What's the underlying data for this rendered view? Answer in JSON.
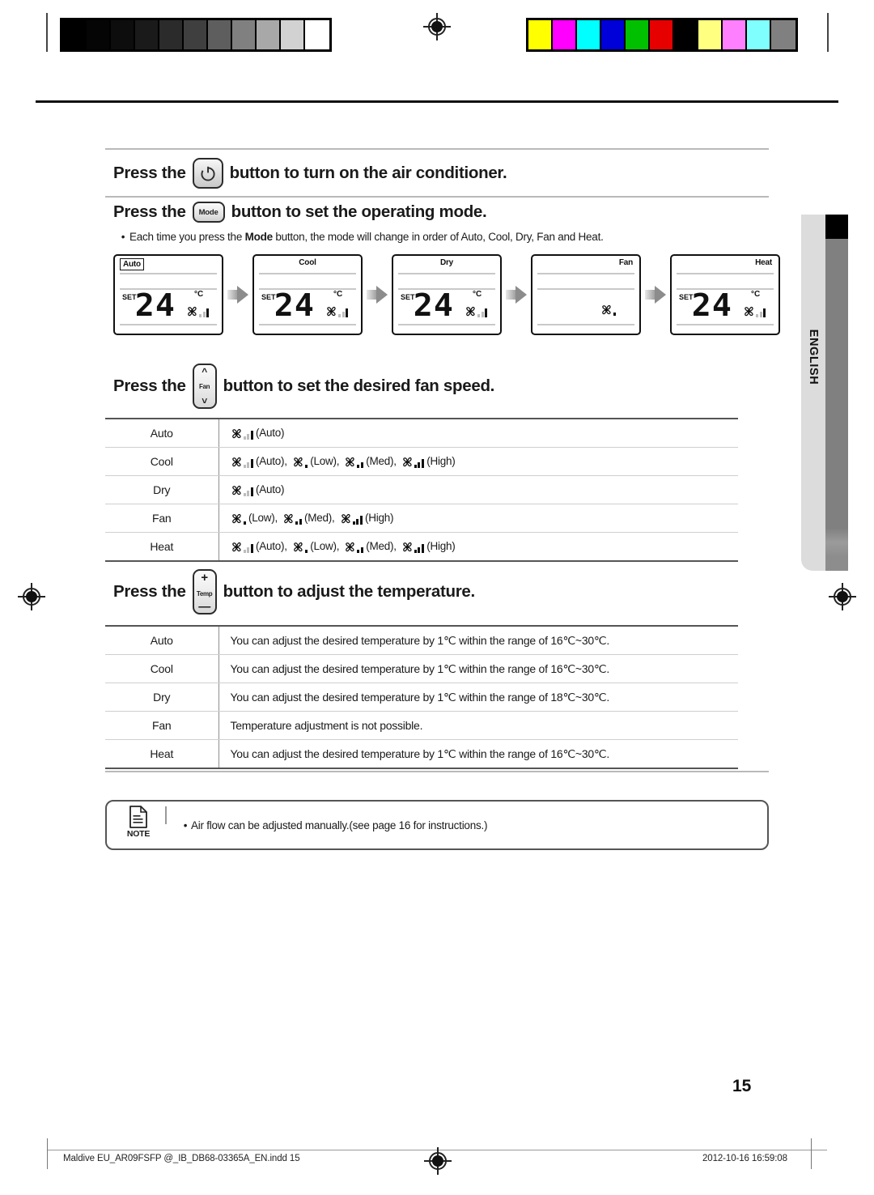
{
  "print_marks": {
    "grayscale_swatches": [
      "#000000",
      "#050505",
      "#0d0d0d",
      "#1a1a1a",
      "#2b2b2b",
      "#3f3f3f",
      "#5e5e5e",
      "#808080",
      "#a8a8a8",
      "#d2d2d2",
      "#ffffff"
    ],
    "color_swatches": [
      "#ffff00",
      "#ff00ff",
      "#00ffff",
      "#0000d8",
      "#00c000",
      "#e60000",
      "#000000",
      "#ffff80",
      "#ff80ff",
      "#80ffff",
      "#808080"
    ]
  },
  "sections": {
    "power": {
      "prefix": "Press the",
      "button_icon": "power-icon",
      "suffix": "button to turn on the air conditioner."
    },
    "mode": {
      "prefix": "Press the",
      "button_label": "Mode",
      "suffix": "button to set the operating mode.",
      "bullet": "Each time you press the Mode button, the mode will change in order of Auto, Cool, Dry, Fan and Heat.",
      "bullet_pre": "Each time you press the ",
      "bullet_bold": "Mode",
      "bullet_post": " button, the mode will change in order of Auto, Cool, Dry, Fan and Heat.",
      "bullet_marker": "•"
    },
    "fan": {
      "prefix": "Press the",
      "button_label": "Fan",
      "suffix": "button to set the desired fan speed."
    },
    "temp": {
      "prefix": "Press the",
      "button_label": "Temp",
      "plus": "+",
      "minus": "—",
      "suffix": "button to adjust the temperature."
    }
  },
  "lcd_sequence": [
    {
      "mode": "Auto",
      "align": "boxed",
      "set_label": "SET",
      "temperature": "24",
      "unit": "°C",
      "show_temp": true,
      "fan_level": "auto"
    },
    {
      "mode": "Cool",
      "align": "center",
      "set_label": "SET",
      "temperature": "24",
      "unit": "°C",
      "show_temp": true,
      "fan_level": "auto"
    },
    {
      "mode": "Dry",
      "align": "center",
      "set_label": "SET",
      "temperature": "24",
      "unit": "°C",
      "show_temp": true,
      "fan_level": "auto"
    },
    {
      "mode": "Fan",
      "align": "right",
      "set_label": "",
      "temperature": "",
      "unit": "",
      "show_temp": false,
      "fan_level": "low"
    },
    {
      "mode": "Heat",
      "align": "right",
      "set_label": "SET",
      "temperature": "24",
      "unit": "°C",
      "show_temp": true,
      "fan_level": "auto"
    }
  ],
  "fan_speed_table": {
    "rows": [
      {
        "mode": "Auto",
        "options": [
          {
            "level": "auto",
            "label": "(Auto)"
          }
        ]
      },
      {
        "mode": "Cool",
        "options": [
          {
            "level": "auto",
            "label": "(Auto),"
          },
          {
            "level": "low",
            "label": "(Low),"
          },
          {
            "level": "med",
            "label": "(Med),"
          },
          {
            "level": "high",
            "label": "(High)"
          }
        ]
      },
      {
        "mode": "Dry",
        "options": [
          {
            "level": "auto",
            "label": "(Auto)"
          }
        ]
      },
      {
        "mode": "Fan",
        "options": [
          {
            "level": "low",
            "label": "(Low),"
          },
          {
            "level": "med",
            "label": "(Med),"
          },
          {
            "level": "high",
            "label": "(High)"
          }
        ]
      },
      {
        "mode": "Heat",
        "options": [
          {
            "level": "auto",
            "label": "(Auto),"
          },
          {
            "level": "low",
            "label": "(Low),"
          },
          {
            "level": "med",
            "label": "(Med),"
          },
          {
            "level": "high",
            "label": "(High)"
          }
        ]
      }
    ]
  },
  "temperature_table": {
    "rows": [
      {
        "mode": "Auto",
        "text": "You can adjust the desired temperature by 1℃ within the range of 16℃~30℃."
      },
      {
        "mode": "Cool",
        "text": "You can adjust the desired temperature by 1℃ within the range of 16℃~30℃."
      },
      {
        "mode": "Dry",
        "text": "You can adjust the desired temperature by 1℃ within the range of 18℃~30℃."
      },
      {
        "mode": "Fan",
        "text": "Temperature adjustment is not possible."
      },
      {
        "mode": "Heat",
        "text": "You can adjust the desired temperature by 1℃ within the range of 16℃~30℃."
      }
    ]
  },
  "note": {
    "label": "NOTE",
    "marker": "•",
    "text": "Air flow can be adjusted manually.(see page 16 for instructions.)"
  },
  "side_tab": {
    "label": "ENGLISH"
  },
  "footer": {
    "page_number": "15",
    "file_name": "Maldive EU_AR09FSFP @_IB_DB68-03365A_EN.indd   15",
    "timestamp": "2012-10-16   16:59:08"
  }
}
